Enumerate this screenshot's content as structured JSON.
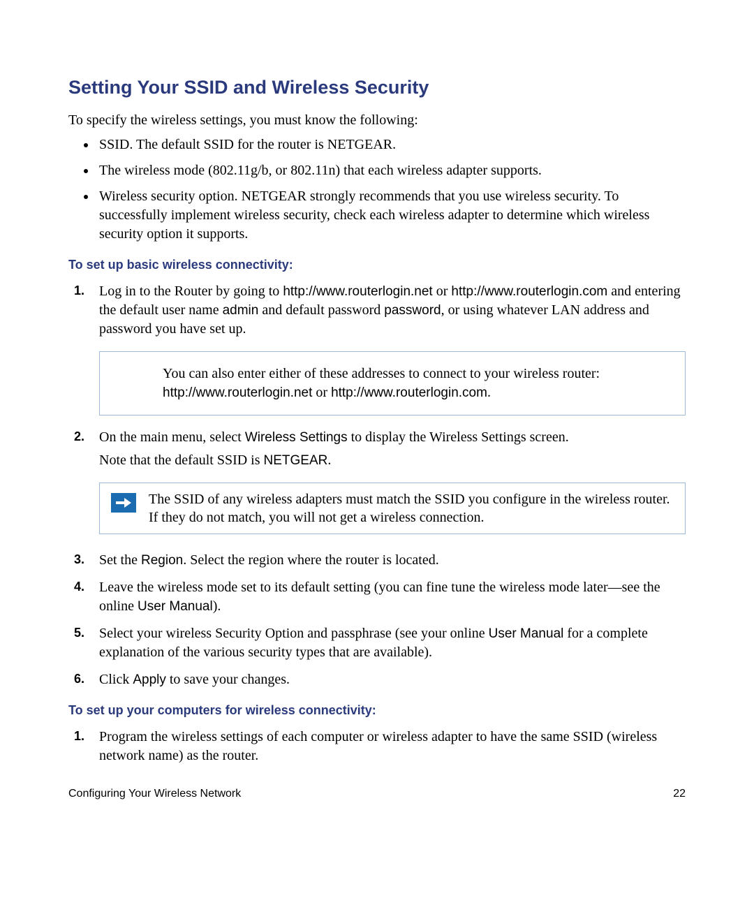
{
  "title": "Setting Your SSID and Wireless Security",
  "intro": "To specify the wireless settings, you must know the following:",
  "bullets": [
    "SSID. The default SSID for the router is NETGEAR.",
    "The wireless mode (802.11g/b, or 802.11n) that each wireless adapter supports.",
    "Wireless security option. NETGEAR strongly recommends that you use wireless security. To successfully implement wireless security, check each wireless adapter to determine which wireless security option it supports."
  ],
  "subhead1": "To set up basic wireless connectivity:",
  "steps1": {
    "s1_a": "Log in to the Router by going to ",
    "s1_url1": "http://www.routerlogin.net",
    "s1_b": " or ",
    "s1_url2": "http://www.routerlogin.com",
    "s1_c": " and entering the default user name ",
    "s1_admin": "admin",
    "s1_d": " and default password ",
    "s1_password": "password",
    "s1_e": ", or using whatever LAN address and password you have set up.",
    "box1_a": "You can also enter either of these addresses to connect to your wireless router: ",
    "box1_url1": "http://www.routerlogin.net",
    "box1_b": " or ",
    "box1_url2": "http://www.routerlogin.com",
    "box1_c": ".",
    "s2_a": "On the main menu, select ",
    "s2_ws": "Wireless Settings",
    "s2_b": " to display the Wireless Settings screen.",
    "s2_note_a": "Note that the default SSID is ",
    "s2_netgear": "NETGEAR",
    "s2_note_b": ".",
    "note_text": "The SSID of any wireless adapters must match the SSID you configure in the wireless router. If they do not match, you will not get a wireless connection.",
    "s3_a": "Set the ",
    "s3_region": "Region",
    "s3_b": ". Select the region where the router is located.",
    "s4_a": "Leave the wireless mode set to its default setting (you can fine tune the wireless mode later—see the online ",
    "s4_manual": "User Manual",
    "s4_b": ").",
    "s5_a": "Select your wireless Security Option and passphrase (see your online ",
    "s5_manual": "User Manual",
    "s5_b": " for a complete explanation of the various security types that are available).",
    "s6_a": "Click ",
    "s6_apply": "Apply",
    "s6_b": " to save your changes."
  },
  "subhead2": "To set up your computers for wireless connectivity:",
  "steps2": {
    "s1": "Program the wireless settings of each computer or wireless adapter to have the same SSID (wireless network name) as the router."
  },
  "footer_left": "Configuring Your Wireless Network",
  "footer_right": "22"
}
